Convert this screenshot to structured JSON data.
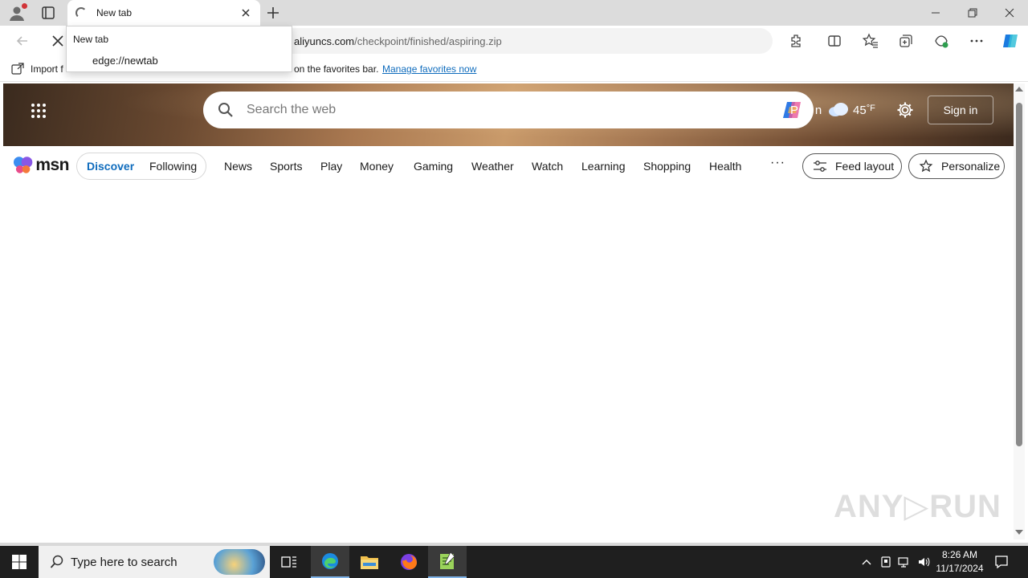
{
  "browser": {
    "tab": {
      "title": "New tab"
    },
    "address": {
      "host": "aliyuncs.com",
      "path": "/checkpoint/finished/aspiring.zip"
    },
    "favorites_bar": {
      "import_label": "Import f",
      "message": "on the favorites bar.",
      "manage_link": "Manage favorites now"
    },
    "suggestion": {
      "title": "New tab",
      "url": "edge://newtab"
    }
  },
  "msn": {
    "search_placeholder": "Search the web",
    "user_name": "Pen n",
    "temperature": "45",
    "temperature_unit": "°F",
    "sign_in": "Sign in",
    "logo_text": "msn",
    "pills": [
      "Discover",
      "Following"
    ],
    "nav": [
      "News",
      "Sports",
      "Play",
      "Money",
      "Gaming",
      "Weather",
      "Watch",
      "Learning",
      "Shopping",
      "Health"
    ],
    "more": "···",
    "feed_layout": "Feed layout",
    "personalize": "Personalize"
  },
  "watermark": "ANY▷RUN",
  "taskbar": {
    "search_text": "Type here to search",
    "time": "8:26 AM",
    "date": "11/17/2024"
  },
  "colors": {
    "accent": "#0f6cbd",
    "taskbar": "#1f1f1f",
    "tab_strip": "#dcdcdc"
  }
}
